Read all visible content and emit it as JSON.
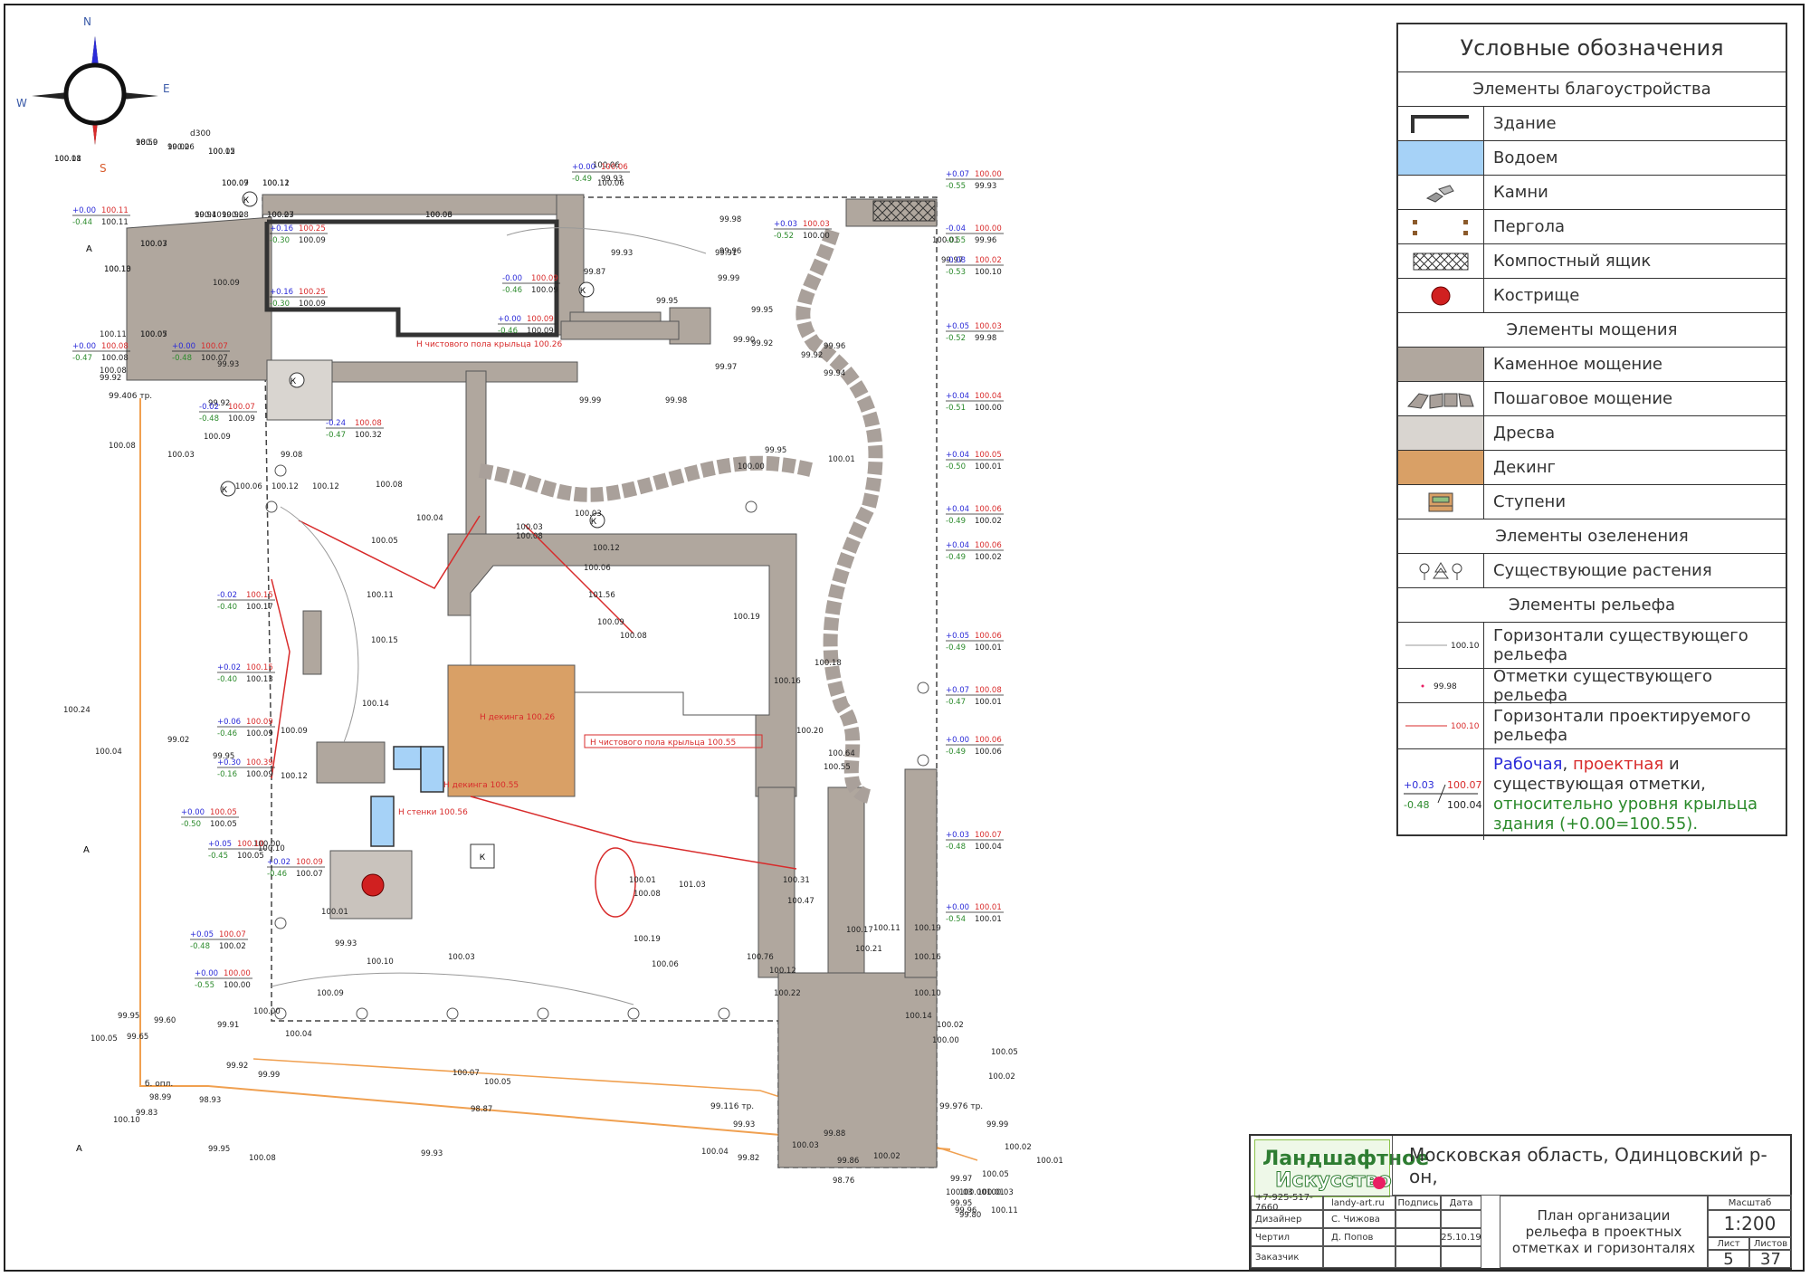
{
  "compass": {
    "n": "N",
    "e": "E",
    "s": "S",
    "w": "W"
  },
  "legend": {
    "title": "Условные обозначения",
    "sections": {
      "improvement": "Элементы благоустройства",
      "paving": "Элементы мощения",
      "greenery": "Элементы озеленения",
      "relief": "Элементы рельефа"
    },
    "items": {
      "building": "Здание",
      "pond": "Водоем",
      "stones": "Камни",
      "pergola": "Пергола",
      "compost": "Компостный ящик",
      "firepit": "Кострище",
      "stone_paving": "Каменное мощение",
      "step_paving": "Пошаговое мощение",
      "gravel": "Дресва",
      "decking": "Декинг",
      "steps": "Ступени",
      "plants": "Существующие растения",
      "existing_contours": "Горизонтали существующего рельефа",
      "existing_marks": "Отметки существующего рельефа",
      "design_contours": "Горизонтали проектируемого рельефа"
    },
    "samples": {
      "existing_contour": "100.10",
      "existing_mark": "99.98",
      "design_contour": "100.10",
      "working": "+0.03",
      "design": "100.07",
      "relative": "-0.48",
      "existing": "100.04"
    },
    "note": {
      "working": "Рабочая",
      "comma1": ",",
      "design": "проектная",
      "and": "и",
      "existing": "существующая отметки,",
      "relative": "относительно уровня крыльца здания (+0.00=100.55)."
    }
  },
  "title_block": {
    "logo_line1": "Ландшафтное",
    "logo_line2": "Искусство",
    "phone": "+7-925-517-7660",
    "site": "landy-art.ru",
    "location": "Московская область, Одинцовский р-он,",
    "sign_label": "Подпись",
    "date_label": "Дата",
    "designer_label": "Дизайнер",
    "designer": "С. Чижова",
    "drafter_label": "Чертил",
    "drafter": "Д. Попов",
    "date": "25.10.19",
    "client_label": "Заказчик",
    "drawing_title": "План организации рельефа в проектных отметках и горизонталях",
    "scale_label": "Масштаб",
    "scale": "1:200",
    "sheet_label": "Лист",
    "sheets_label": "Листов",
    "sheet": "5",
    "sheets": "37"
  },
  "plan": {
    "markers": {
      "a": "А",
      "k": "К"
    },
    "callouts": [
      "Н чистового пола крыльца 100.26",
      "Н чистового пола крыльца 100.55",
      "Н декинга 100.26",
      "Н декинга 100.55",
      "Н стенки 100.56"
    ],
    "pipe_labels": [
      "d300",
      "99.406 тр.",
      "99.116 тр.",
      "99.976 тр.",
      "б. опл."
    ],
    "existing_marks": [
      {
        "v": "100.18"
      },
      {
        "v": "100.0"
      },
      {
        "v": "99.02"
      },
      {
        "v": "100.02"
      },
      {
        "v": "100.09"
      },
      {
        "v": "100.11"
      },
      {
        "v": "100.23"
      },
      {
        "v": "100.06"
      },
      {
        "v": "99.94"
      },
      {
        "v": "99.92"
      },
      {
        "v": "100.07"
      },
      {
        "v": "100.10"
      },
      {
        "v": "100.05"
      },
      {
        "v": "100.09"
      },
      {
        "v": "100.11"
      },
      {
        "v": "100.08"
      },
      {
        "v": "99.92"
      },
      {
        "v": "99.93"
      },
      {
        "v": "99.92"
      },
      {
        "v": "100.09"
      },
      {
        "v": "100.08"
      },
      {
        "v": "100.03"
      },
      {
        "v": "99.08"
      },
      {
        "v": "100.06"
      },
      {
        "v": "100.12"
      },
      {
        "v": "100.12"
      },
      {
        "v": "100.08"
      },
      {
        "v": "100.04"
      },
      {
        "v": "100.05"
      },
      {
        "v": "100.11"
      },
      {
        "v": "100.15"
      },
      {
        "v": "100.14"
      },
      {
        "v": "100.24"
      },
      {
        "v": "100.04"
      },
      {
        "v": "99.02"
      },
      {
        "v": "99.95"
      },
      {
        "v": "100.09"
      },
      {
        "v": "100.12"
      },
      {
        "v": "100.10"
      },
      {
        "v": "100.00"
      },
      {
        "v": "100.01"
      },
      {
        "v": "99.93"
      },
      {
        "v": "100.10"
      },
      {
        "v": "100.03"
      },
      {
        "v": "100.09"
      },
      {
        "v": "100.00"
      },
      {
        "v": "100.04"
      },
      {
        "v": "99.95"
      },
      {
        "v": "99.60"
      },
      {
        "v": "99.65"
      },
      {
        "v": "100.05"
      },
      {
        "v": "99.91"
      },
      {
        "v": "99.92"
      },
      {
        "v": "99.99"
      },
      {
        "v": "98.99"
      },
      {
        "v": "98.93"
      },
      {
        "v": "99.83"
      },
      {
        "v": "100.10"
      },
      {
        "v": "98.87"
      },
      {
        "v": "99.95"
      },
      {
        "v": "100.08"
      },
      {
        "v": "99.93"
      },
      {
        "v": "100.07"
      },
      {
        "v": "100.05"
      },
      {
        "v": "100.04"
      },
      {
        "v": "99.82"
      },
      {
        "v": "99.93"
      },
      {
        "v": "100.03"
      },
      {
        "v": "98.76"
      },
      {
        "v": "100.02"
      },
      {
        "v": "99.88"
      },
      {
        "v": "99.86"
      },
      {
        "v": "100.06"
      },
      {
        "v": "100.06"
      },
      {
        "v": "99.98"
      },
      {
        "v": "99.87"
      },
      {
        "v": "99.93"
      },
      {
        "v": "99.91"
      },
      {
        "v": "99.96"
      },
      {
        "v": "99.99"
      },
      {
        "v": "99.95"
      },
      {
        "v": "99.90"
      },
      {
        "v": "99.97"
      },
      {
        "v": "99.92"
      },
      {
        "v": "99.96"
      },
      {
        "v": "99.92"
      },
      {
        "v": "99.94"
      },
      {
        "v": "99.95"
      },
      {
        "v": "99.99"
      },
      {
        "v": "99.98"
      },
      {
        "v": "99.95"
      },
      {
        "v": "100.01"
      },
      {
        "v": "100.00"
      },
      {
        "v": "100.01"
      },
      {
        "v": "99.97"
      },
      {
        "v": "100.03"
      },
      {
        "v": "100.03"
      },
      {
        "v": "100.08"
      },
      {
        "v": "100.12"
      },
      {
        "v": "100.06"
      },
      {
        "v": "101.56"
      },
      {
        "v": "100.09"
      },
      {
        "v": "100.08"
      },
      {
        "v": "100.19"
      },
      {
        "v": "100.18"
      },
      {
        "v": "100.16"
      },
      {
        "v": "100.20"
      },
      {
        "v": "100.64"
      },
      {
        "v": "100.55"
      },
      {
        "v": "100.31"
      },
      {
        "v": "100.47"
      },
      {
        "v": "100.01"
      },
      {
        "v": "100.08"
      },
      {
        "v": "101.03"
      },
      {
        "v": "100.19"
      },
      {
        "v": "100.06"
      },
      {
        "v": "100.76"
      },
      {
        "v": "100.12"
      },
      {
        "v": "100.22"
      },
      {
        "v": "100.17"
      },
      {
        "v": "100.11"
      },
      {
        "v": "100.21"
      },
      {
        "v": "100.19"
      },
      {
        "v": "100.16"
      },
      {
        "v": "100.10"
      },
      {
        "v": "100.14"
      },
      {
        "v": "100.02"
      },
      {
        "v": "100.00"
      },
      {
        "v": "100.05"
      },
      {
        "v": "100.02"
      },
      {
        "v": "100.02"
      },
      {
        "v": "100.01"
      },
      {
        "v": "99.99"
      },
      {
        "v": "100.03"
      },
      {
        "v": "99.97"
      },
      {
        "v": "100.00"
      },
      {
        "v": "100.01"
      },
      {
        "v": "100.03"
      },
      {
        "v": "100.05"
      },
      {
        "v": "99.95"
      },
      {
        "v": "99.96"
      },
      {
        "v": "100.11"
      },
      {
        "v": "99.80"
      },
      {
        "v": "100.01"
      },
      {
        "v": "98.59"
      },
      {
        "v": "100.06"
      },
      {
        "v": "100.15"
      },
      {
        "v": "100.07"
      },
      {
        "v": "100.12"
      },
      {
        "v": "100.07"
      },
      {
        "v": "100.03"
      },
      {
        "v": "100.10"
      },
      {
        "v": "100.08"
      },
      {
        "v": "100.03"
      },
      {
        "v": "100.13"
      },
      {
        "v": "100.07"
      }
    ],
    "working_marks": [
      {
        "w": "+0.00",
        "d": "100.06",
        "r": "-0.49",
        "e": "99.93"
      },
      {
        "w": "+0.07",
        "d": "100.00",
        "r": "-0.55",
        "e": "99.93"
      },
      {
        "w": "+0.00",
        "d": "100.11",
        "r": "-0.44",
        "e": "100.11"
      },
      {
        "w": "+0.16",
        "d": "100.25",
        "r": "-0.30",
        "e": "100.09"
      },
      {
        "w": "+0.16",
        "d": "100.25",
        "r": "-0.30",
        "e": "100.09"
      },
      {
        "w": "+0.00",
        "d": "100.08",
        "r": "-0.47",
        "e": "100.08"
      },
      {
        "w": "+0.00",
        "d": "100.07",
        "r": "-0.48",
        "e": "100.07"
      },
      {
        "w": "-0.00",
        "d": "100.09",
        "r": "-0.46",
        "e": "100.09"
      },
      {
        "w": "+0.00",
        "d": "100.09",
        "r": "-0.46",
        "e": "100.09"
      },
      {
        "w": "+0.03",
        "d": "100.03",
        "r": "-0.52",
        "e": "100.00"
      },
      {
        "w": "-0.04",
        "d": "100.00",
        "r": "-0.55",
        "e": "99.96"
      },
      {
        "w": "-0.08",
        "d": "100.02",
        "r": "-0.53",
        "e": "100.10"
      },
      {
        "w": "+0.05",
        "d": "100.03",
        "r": "-0.52",
        "e": "99.98"
      },
      {
        "w": "+0.04",
        "d": "100.04",
        "r": "-0.51",
        "e": "100.00"
      },
      {
        "w": "+0.04",
        "d": "100.05",
        "r": "-0.50",
        "e": "100.01"
      },
      {
        "w": "+0.04",
        "d": "100.06",
        "r": "-0.49",
        "e": "100.02"
      },
      {
        "w": "+0.04",
        "d": "100.06",
        "r": "-0.49",
        "e": "100.02"
      },
      {
        "w": "+0.05",
        "d": "100.06",
        "r": "-0.49",
        "e": "100.01"
      },
      {
        "w": "+0.07",
        "d": "100.08",
        "r": "-0.47",
        "e": "100.01"
      },
      {
        "w": "+0.00",
        "d": "100.06",
        "r": "-0.49",
        "e": "100.06"
      },
      {
        "w": "+0.03",
        "d": "100.07",
        "r": "-0.48",
        "e": "100.04"
      },
      {
        "w": "+0.00",
        "d": "100.01",
        "r": "-0.54",
        "e": "100.01"
      },
      {
        "w": "+0.02",
        "d": "100.09",
        "r": "-0.46",
        "e": "100.07"
      },
      {
        "w": "-0.02",
        "d": "100.07",
        "r": "-0.48",
        "e": "100.09"
      },
      {
        "w": "-0.24",
        "d": "100.08",
        "r": "-0.47",
        "e": "100.32"
      },
      {
        "w": "-0.02",
        "d": "100.15",
        "r": "-0.40",
        "e": "100.17"
      },
      {
        "w": "+0.02",
        "d": "100.15",
        "r": "-0.40",
        "e": "100.13"
      },
      {
        "w": "+0.06",
        "d": "100.09",
        "r": "-0.46",
        "e": "100.09"
      },
      {
        "w": "+0.30",
        "d": "100.39",
        "r": "-0.16",
        "e": "100.09"
      },
      {
        "w": "+0.00",
        "d": "100.05",
        "r": "-0.50",
        "e": "100.05"
      },
      {
        "w": "+0.05",
        "d": "100.10",
        "r": "-0.45",
        "e": "100.05"
      },
      {
        "w": "+0.05",
        "d": "100.07",
        "r": "-0.48",
        "e": "100.02"
      },
      {
        "w": "+0.00",
        "d": "100.00",
        "r": "-0.55",
        "e": "100.00"
      }
    ]
  }
}
